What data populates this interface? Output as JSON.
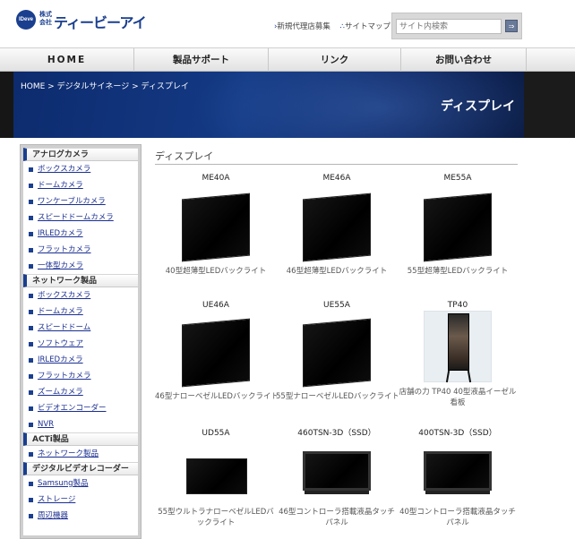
{
  "header": {
    "logo_mark": "IDeve",
    "logo_kaisha": "株式\n会社",
    "logo_name": "ティービーアイ",
    "links": [
      "新規代理店募集",
      "サイトマップ"
    ],
    "search_placeholder": "サイト内検索",
    "search_button": "⇒"
  },
  "nav": [
    "HOME",
    "製品サポート",
    "リンク",
    "お問い合わせ"
  ],
  "banner": {
    "breadcrumb": "HOME > デジタルサイネージ > ディスプレイ",
    "title": "ディスプレイ"
  },
  "sidebar": [
    {
      "heading": "アナログカメラ",
      "items": [
        "ボックスカメラ",
        "ドームカメラ",
        "ワンケーブルカメラ",
        "スピードドームカメラ",
        "IRLEDカメラ",
        "フラットカメラ",
        "一体型カメラ"
      ]
    },
    {
      "heading": "ネットワーク製品",
      "items": [
        "ボックスカメラ",
        "ドームカメラ",
        "スピードドーム",
        "ソフトウェア",
        "IRLEDカメラ",
        "フラットカメラ",
        "ズームカメラ",
        "ビデオエンコーダー",
        "NVR"
      ]
    },
    {
      "heading": "ACTi製品",
      "items": [
        "ネットワーク製品"
      ]
    },
    {
      "heading": "デジタルビデオレコーダー",
      "items": [
        "Samsung製品",
        "ストレージ",
        "周辺機器"
      ]
    }
  ],
  "main": {
    "title": "ディスプレイ",
    "products": [
      {
        "name": "ME40A",
        "desc": "40型超薄型LEDバックライト"
      },
      {
        "name": "ME46A",
        "desc": "46型超薄型LEDバックライト"
      },
      {
        "name": "ME55A",
        "desc": "55型超薄型LEDバックライト"
      },
      {
        "name": "UE46A",
        "desc": "46型ナローベゼルLEDバックライト"
      },
      {
        "name": "UE55A",
        "desc": "55型ナローベゼルLEDバックライト"
      },
      {
        "name": "TP40",
        "desc": "店舗の力 TP40 40型液晶イーゼル看板"
      },
      {
        "name": "UD55A",
        "desc": "55型ウルトラナローベゼルLEDバックライト"
      },
      {
        "name": "460TSN-3D（SSD）",
        "desc": "46型コントローラ搭載液晶タッチパネル"
      },
      {
        "name": "400TSN-3D（SSD）",
        "desc": "40型コントローラ搭載液晶タッチパネル"
      }
    ]
  }
}
